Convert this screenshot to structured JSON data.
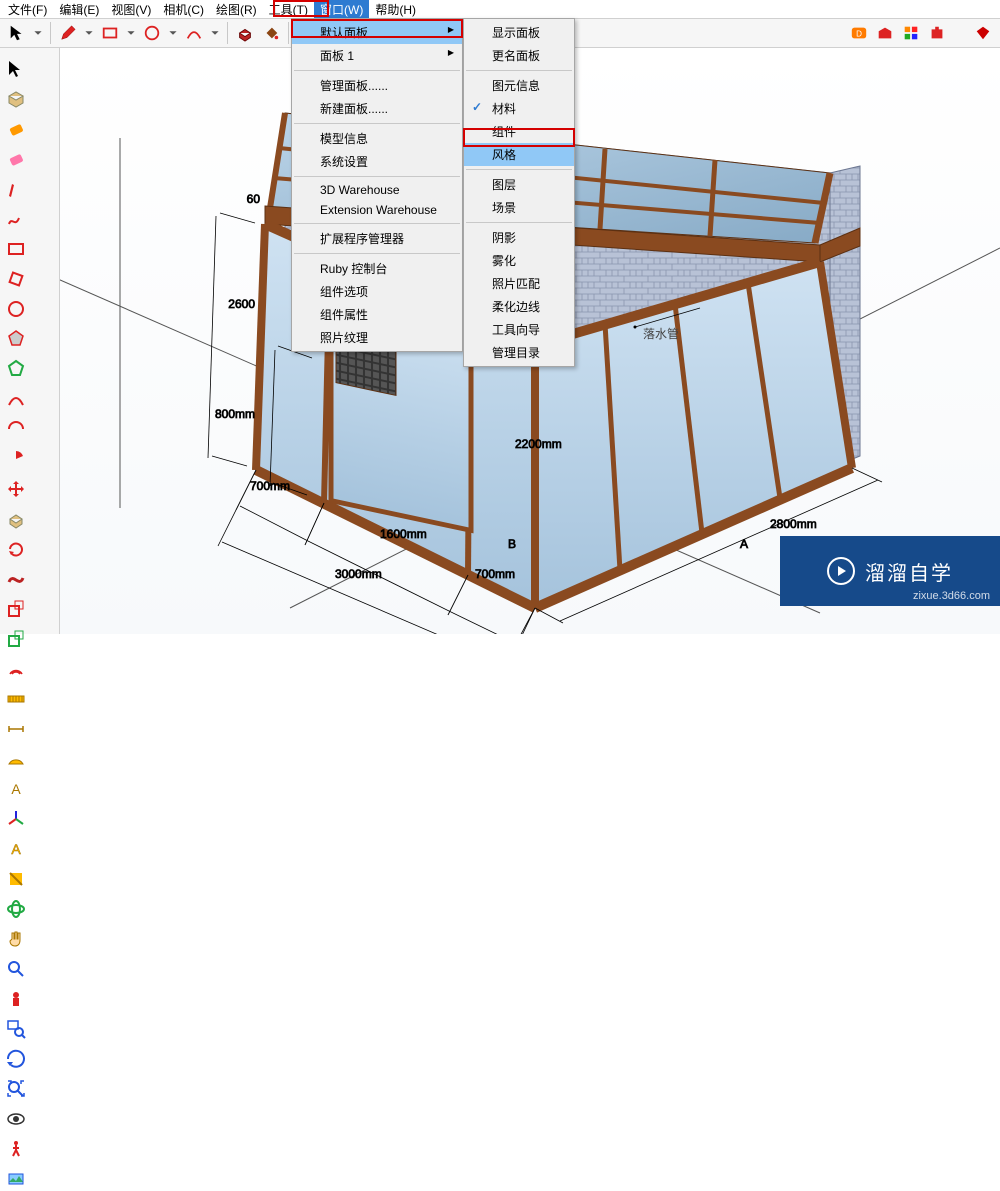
{
  "menubar": {
    "items": [
      "文件(F)",
      "编辑(E)",
      "视图(V)",
      "相机(C)",
      "绘图(R)",
      "工具(T)",
      "窗口(W)",
      "帮助(H)"
    ],
    "open_index": 6
  },
  "menu1": {
    "items": [
      {
        "label": "默认面板",
        "arrow": true,
        "hover": true
      },
      {
        "label": "面板 1",
        "arrow": true
      },
      {
        "sep": true
      },
      {
        "label": "管理面板......"
      },
      {
        "label": "新建面板......"
      },
      {
        "sep": true
      },
      {
        "label": "模型信息"
      },
      {
        "label": "系统设置"
      },
      {
        "sep": true
      },
      {
        "label": "3D Warehouse"
      },
      {
        "label": "Extension Warehouse"
      },
      {
        "sep": true
      },
      {
        "label": "扩展程序管理器"
      },
      {
        "sep": true
      },
      {
        "label": "Ruby 控制台"
      },
      {
        "label": "组件选项"
      },
      {
        "label": "组件属性"
      },
      {
        "label": "照片纹理"
      }
    ]
  },
  "menu2": {
    "items": [
      {
        "label": "显示面板"
      },
      {
        "label": "更名面板"
      },
      {
        "sep": true
      },
      {
        "label": "图元信息"
      },
      {
        "label": "材料",
        "check": true
      },
      {
        "label": "组件"
      },
      {
        "label": "风格",
        "hover": true
      },
      {
        "sep": true
      },
      {
        "label": "图层"
      },
      {
        "label": "场景"
      },
      {
        "sep": true
      },
      {
        "label": "阴影"
      },
      {
        "label": "雾化"
      },
      {
        "label": "照片匹配"
      },
      {
        "label": "柔化边线"
      },
      {
        "label": "工具向导"
      },
      {
        "label": "管理目录"
      }
    ]
  },
  "annotations": {
    "label_a": "落水管",
    "dims": {
      "d_60": "60",
      "d_2600": "2600",
      "d_800": "800mm",
      "d_700a": "700mm",
      "d_1600": "1600mm",
      "d_3000": "3000mm",
      "d_700b": "700mm",
      "d_2200": "2200mm",
      "d_2800": "2800mm",
      "mark_a": "A",
      "mark_b": "B"
    }
  },
  "watermark": {
    "text": "溜溜自学",
    "sub": "zixue.3d66.com"
  },
  "toolbar_h_icons": [
    "select-arrow",
    "dropdown",
    "eraser",
    "pencil",
    "line-dd",
    "rectangle",
    "circle",
    "arc",
    "pushpull",
    "offset",
    "move",
    "rotate",
    "scale",
    "tape",
    "text",
    "paint",
    "orbit",
    "pan",
    "zoom",
    "zoom-ext",
    "warehouse",
    "ext-wh",
    "layers",
    "add-comp"
  ],
  "toolbar_v_icons": [
    "arrow",
    "cube",
    "eraser",
    "eraser-pink",
    "pencil",
    "freehand",
    "rectangle",
    "rectangle2",
    "circle",
    "polygon",
    "polygon2",
    "arc",
    "arc2",
    "pie",
    "pushpull",
    "offset",
    "move",
    "follow",
    "rotate",
    "scale",
    "scale2",
    "tape",
    "tape2",
    "protractor",
    "dimension",
    "text",
    "text3d",
    "paint",
    "axes",
    "orbit",
    "section",
    "pan",
    "pan2",
    "zoom",
    "position",
    "zoom-win",
    "prev",
    "walk",
    "look",
    "photo"
  ]
}
